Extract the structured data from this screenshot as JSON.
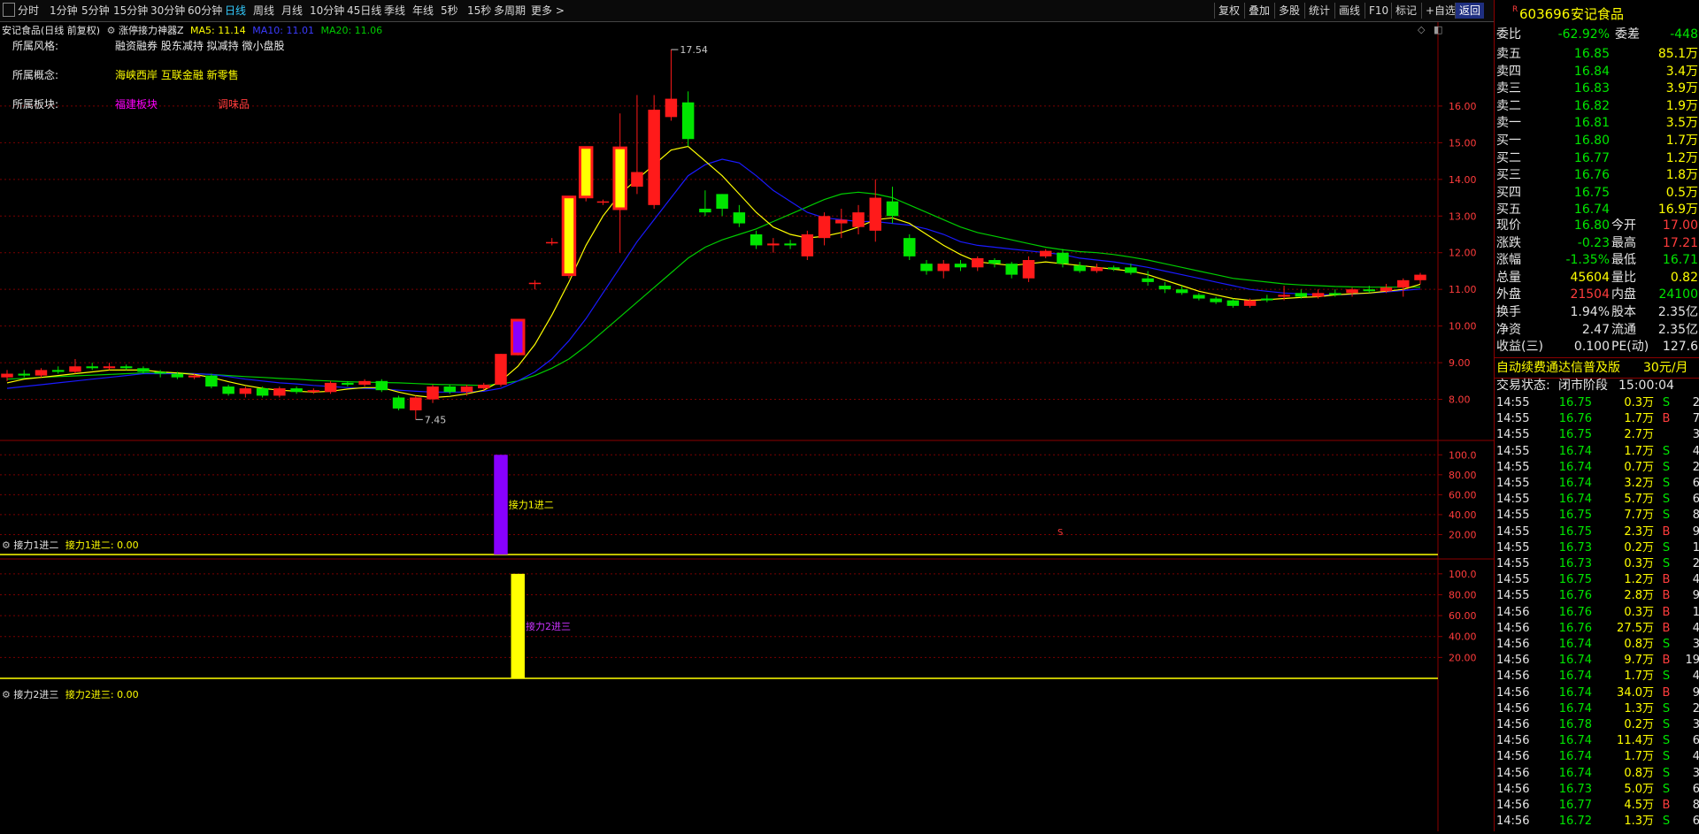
{
  "toolbar": {
    "periods": [
      "分时",
      "1分钟",
      "5分钟",
      "15分钟",
      "30分钟",
      "60分钟",
      "日线",
      "周线",
      "月线",
      "10分钟",
      "45日线",
      "季线",
      "年线",
      "5秒",
      "15秒",
      "多周期",
      "更多 >"
    ],
    "active_period": "日线",
    "right_buttons": [
      "复权",
      "叠加",
      "多股",
      "统计",
      "画线",
      "F10",
      "标记",
      "+自选",
      "返回"
    ],
    "active_right": "返回"
  },
  "main_chart": {
    "title": "安记食品(日线 前复权)",
    "indicator_name": "涨停接力神器Z",
    "ma5_label": "MA5: 11.14",
    "ma10_label": "MA10: 11.01",
    "ma20_label": "MA20: 11.06",
    "info": [
      {
        "label": "所属风格:",
        "value": "融资融券 股东减持 拟减持 微小盘股"
      },
      {
        "label": "所属概念:",
        "value": "海峡西岸 互联金融 新零售"
      },
      {
        "label": "所属板块:",
        "value": "福建板块",
        "value2": "调味品"
      }
    ],
    "high_marker": "17.54",
    "low_marker": "7.45",
    "y_ticks": [
      "16.00",
      "15.00",
      "14.00",
      "13.00",
      "12.00",
      "11.00",
      "10.00",
      "9.00",
      "8.00"
    ],
    "bottom_marker": "S",
    "colors": {
      "up": "#ff1a1a",
      "down": "#00e600",
      "ma5": "#ffff00",
      "ma10": "#1a1aff",
      "ma20": "#00cc00",
      "grid": "#7a0000"
    }
  },
  "chart_data": {
    "type": "candlestick",
    "y_range": [
      7.0,
      18.0
    ],
    "candles": [
      [
        8.6,
        8.7,
        8.5,
        8.8
      ],
      [
        8.7,
        8.65,
        8.6,
        8.8
      ],
      [
        8.65,
        8.8,
        8.6,
        8.85
      ],
      [
        8.8,
        8.75,
        8.7,
        8.9
      ],
      [
        8.75,
        8.9,
        8.7,
        9.1
      ],
      [
        8.9,
        8.85,
        8.8,
        9.0
      ],
      [
        8.85,
        8.9,
        8.8,
        9.0
      ],
      [
        8.9,
        8.85,
        8.8,
        8.95
      ],
      [
        8.85,
        8.75,
        8.7,
        8.9
      ],
      [
        8.75,
        8.7,
        8.6,
        8.8
      ],
      [
        8.7,
        8.6,
        8.55,
        8.75
      ],
      [
        8.6,
        8.65,
        8.55,
        8.7
      ],
      [
        8.65,
        8.35,
        8.3,
        8.7
      ],
      [
        8.35,
        8.15,
        8.1,
        8.4
      ],
      [
        8.15,
        8.3,
        8.05,
        8.35
      ],
      [
        8.3,
        8.1,
        8.05,
        8.35
      ],
      [
        8.1,
        8.3,
        8.05,
        8.35
      ],
      [
        8.3,
        8.2,
        8.15,
        8.35
      ],
      [
        8.2,
        8.25,
        8.15,
        8.3
      ],
      [
        8.2,
        8.45,
        8.15,
        8.5
      ],
      [
        8.45,
        8.4,
        8.35,
        8.5
      ],
      [
        8.4,
        8.5,
        8.35,
        8.55
      ],
      [
        8.5,
        8.25,
        8.2,
        8.55
      ],
      [
        8.05,
        7.75,
        7.7,
        8.1
      ],
      [
        7.7,
        8.05,
        7.45,
        8.1
      ],
      [
        8.0,
        8.35,
        7.9,
        8.4
      ],
      [
        8.35,
        8.2,
        8.15,
        8.4
      ],
      [
        8.2,
        8.35,
        8.1,
        8.4
      ],
      [
        8.3,
        8.4,
        8.25,
        8.45
      ],
      [
        8.4,
        9.24,
        8.35,
        9.24
      ],
      [
        9.24,
        10.16,
        9.2,
        10.16
      ],
      [
        11.18,
        11.18,
        11.0,
        11.25
      ],
      [
        12.29,
        12.29,
        12.2,
        12.4
      ],
      [
        11.4,
        13.52,
        11.3,
        13.52
      ],
      [
        13.52,
        14.87,
        13.4,
        14.87
      ],
      [
        13.4,
        13.4,
        13.3,
        13.45
      ],
      [
        13.2,
        14.86,
        12.0,
        15.8
      ],
      [
        13.8,
        14.2,
        13.6,
        16.3
      ],
      [
        13.3,
        15.9,
        13.2,
        16.3
      ],
      [
        15.7,
        16.2,
        15.6,
        17.54
      ],
      [
        16.1,
        15.1,
        14.9,
        16.4
      ],
      [
        13.2,
        13.1,
        13.0,
        13.7
      ],
      [
        13.6,
        13.2,
        13.0,
        13.6
      ],
      [
        13.1,
        12.8,
        12.7,
        13.3
      ],
      [
        12.5,
        12.2,
        12.1,
        12.6
      ],
      [
        12.2,
        12.25,
        12.0,
        12.4
      ],
      [
        12.25,
        12.2,
        12.1,
        12.35
      ],
      [
        11.9,
        12.5,
        11.8,
        12.6
      ],
      [
        12.4,
        13.0,
        12.2,
        13.1
      ],
      [
        12.8,
        12.9,
        12.4,
        13.2
      ],
      [
        12.7,
        13.1,
        12.5,
        13.3
      ],
      [
        12.6,
        13.5,
        12.3,
        14.0
      ],
      [
        13.4,
        13.0,
        12.8,
        13.8
      ],
      [
        12.4,
        11.9,
        11.8,
        12.5
      ],
      [
        11.7,
        11.5,
        11.4,
        11.8
      ],
      [
        11.5,
        11.7,
        11.3,
        11.8
      ],
      [
        11.7,
        11.6,
        11.5,
        11.8
      ],
      [
        11.6,
        11.85,
        11.5,
        11.9
      ],
      [
        11.8,
        11.7,
        11.6,
        11.85
      ],
      [
        11.7,
        11.4,
        11.3,
        11.75
      ],
      [
        11.3,
        11.8,
        11.2,
        11.9
      ],
      [
        11.9,
        12.05,
        11.85,
        12.1
      ],
      [
        12.0,
        11.7,
        11.6,
        12.1
      ],
      [
        11.65,
        11.5,
        11.45,
        11.75
      ],
      [
        11.5,
        11.6,
        11.45,
        11.7
      ],
      [
        11.6,
        11.55,
        11.5,
        11.65
      ],
      [
        11.6,
        11.45,
        11.4,
        11.7
      ],
      [
        11.3,
        11.2,
        11.1,
        11.5
      ],
      [
        11.1,
        11.0,
        10.9,
        11.2
      ],
      [
        11.0,
        10.9,
        10.85,
        11.1
      ],
      [
        10.85,
        10.75,
        10.7,
        10.9
      ],
      [
        10.75,
        10.65,
        10.6,
        10.8
      ],
      [
        10.7,
        10.55,
        10.5,
        10.75
      ],
      [
        10.55,
        10.7,
        10.5,
        10.75
      ],
      [
        10.75,
        10.7,
        10.65,
        10.85
      ],
      [
        10.8,
        10.85,
        10.7,
        11.1
      ],
      [
        10.9,
        10.8,
        10.75,
        11.0
      ],
      [
        10.8,
        10.9,
        10.75,
        11.0
      ],
      [
        10.9,
        10.85,
        10.8,
        11.0
      ],
      [
        10.9,
        11.0,
        10.8,
        11.05
      ],
      [
        11.0,
        10.95,
        10.9,
        11.1
      ],
      [
        10.95,
        11.05,
        10.9,
        11.15
      ],
      [
        11.05,
        11.25,
        10.8,
        11.3
      ],
      [
        11.25,
        11.4,
        11.15,
        11.45
      ]
    ],
    "ma5": [
      8.45,
      8.55,
      8.6,
      8.65,
      8.7,
      8.75,
      8.8,
      8.8,
      8.8,
      8.75,
      8.72,
      8.68,
      8.6,
      8.48,
      8.38,
      8.3,
      8.25,
      8.22,
      8.2,
      8.22,
      8.28,
      8.32,
      8.32,
      8.2,
      8.1,
      8.05,
      8.08,
      8.15,
      8.25,
      8.5,
      8.9,
      9.5,
      10.3,
      11.2,
      12.2,
      13.0,
      13.6,
      14.0,
      14.4,
      14.8,
      14.9,
      14.5,
      14.1,
      13.6,
      13.1,
      12.7,
      12.5,
      12.4,
      12.45,
      12.55,
      12.7,
      12.9,
      12.95,
      12.8,
      12.5,
      12.2,
      11.95,
      11.75,
      11.7,
      11.65,
      11.7,
      11.75,
      11.7,
      11.65,
      11.6,
      11.55,
      11.5,
      11.4,
      11.25,
      11.1,
      10.95,
      10.85,
      10.75,
      10.7,
      10.72,
      10.75,
      10.78,
      10.8,
      10.85,
      10.88,
      10.9,
      10.95,
      11.0,
      11.14
    ],
    "ma10": [
      8.3,
      8.35,
      8.4,
      8.45,
      8.5,
      8.55,
      8.6,
      8.65,
      8.7,
      8.7,
      8.7,
      8.7,
      8.68,
      8.62,
      8.55,
      8.5,
      8.45,
      8.42,
      8.38,
      8.35,
      8.32,
      8.3,
      8.28,
      8.25,
      8.22,
      8.2,
      8.2,
      8.2,
      8.22,
      8.3,
      8.5,
      8.75,
      9.1,
      9.6,
      10.2,
      10.9,
      11.6,
      12.3,
      12.9,
      13.5,
      14.1,
      14.4,
      14.55,
      14.45,
      14.1,
      13.7,
      13.4,
      13.1,
      12.95,
      12.9,
      12.85,
      12.85,
      12.8,
      12.75,
      12.65,
      12.5,
      12.3,
      12.2,
      12.15,
      12.1,
      12.05,
      12.0,
      11.95,
      11.85,
      11.8,
      11.75,
      11.68,
      11.6,
      11.5,
      11.4,
      11.3,
      11.2,
      11.1,
      11.0,
      10.95,
      10.9,
      10.88,
      10.85,
      10.85,
      10.87,
      10.9,
      10.93,
      10.97,
      11.01
    ],
    "ma20": [
      8.55,
      8.57,
      8.6,
      8.62,
      8.64,
      8.66,
      8.68,
      8.7,
      8.72,
      8.72,
      8.72,
      8.7,
      8.68,
      8.65,
      8.62,
      8.6,
      8.57,
      8.55,
      8.52,
      8.5,
      8.48,
      8.47,
      8.46,
      8.45,
      8.43,
      8.41,
      8.4,
      8.39,
      8.38,
      8.42,
      8.5,
      8.65,
      8.85,
      9.1,
      9.45,
      9.85,
      10.25,
      10.65,
      11.05,
      11.45,
      11.85,
      12.15,
      12.35,
      12.5,
      12.65,
      12.85,
      13.05,
      13.25,
      13.45,
      13.6,
      13.65,
      13.6,
      13.5,
      13.3,
      13.1,
      12.9,
      12.7,
      12.55,
      12.45,
      12.35,
      12.25,
      12.15,
      12.08,
      12.03,
      12.0,
      11.95,
      11.88,
      11.8,
      11.7,
      11.6,
      11.5,
      11.4,
      11.3,
      11.25,
      11.2,
      11.15,
      11.12,
      11.1,
      11.08,
      11.07,
      11.06,
      11.06,
      11.06,
      11.06
    ],
    "sub1_bar_index": 29,
    "sub2_bar_index": 30,
    "sub_y_range": [
      0,
      110
    ]
  },
  "sub1": {
    "title": "接力1进二",
    "label": "接力1进二: 0.00",
    "annotation": "接力1进二",
    "bar_value": 100,
    "y_ticks": [
      "100.0",
      "80.00",
      "60.00",
      "40.00",
      "20.00"
    ],
    "bar_color": "#8800ff"
  },
  "sub2": {
    "title": "接力2进三",
    "label": "接力2进三: 0.00",
    "annotation": "接力2进三",
    "bar_value": 100,
    "y_ticks": [
      "100.0",
      "80.00",
      "60.00",
      "40.00",
      "20.00"
    ],
    "bar_color": "#ffff00"
  },
  "quote": {
    "code": "603696",
    "name": "安记食品",
    "weibi_label": "委比",
    "weibi": "-62.92%",
    "weicha_label": "委差",
    "weicha": "-448",
    "asks": [
      {
        "label": "卖五",
        "price": "16.85",
        "vol": "85.1万"
      },
      {
        "label": "卖四",
        "price": "16.84",
        "vol": "3.4万"
      },
      {
        "label": "卖三",
        "price": "16.83",
        "vol": "3.9万"
      },
      {
        "label": "卖二",
        "price": "16.82",
        "vol": "1.9万"
      },
      {
        "label": "卖一",
        "price": "16.81",
        "vol": "3.5万"
      }
    ],
    "bids": [
      {
        "label": "买一",
        "price": "16.80",
        "vol": "1.7万"
      },
      {
        "label": "买二",
        "price": "16.77",
        "vol": "1.2万"
      },
      {
        "label": "买三",
        "price": "16.76",
        "vol": "1.8万"
      },
      {
        "label": "买四",
        "price": "16.75",
        "vol": "0.5万"
      },
      {
        "label": "买五",
        "price": "16.74",
        "vol": "16.9万"
      }
    ],
    "stats": [
      {
        "l1": "现价",
        "v1": "16.80",
        "c1": "green",
        "l2": "今开",
        "v2": "17.00",
        "c2": "red"
      },
      {
        "l1": "涨跌",
        "v1": "-0.23",
        "c1": "green",
        "l2": "最高",
        "v2": "17.21",
        "c2": "red"
      },
      {
        "l1": "涨幅",
        "v1": "-1.35%",
        "c1": "green",
        "l2": "最低",
        "v2": "16.71",
        "c2": "green"
      },
      {
        "l1": "总量",
        "v1": "45604",
        "c1": "yellow",
        "l2": "量比",
        "v2": "0.82",
        "c2": "yellow"
      },
      {
        "l1": "外盘",
        "v1": "21504",
        "c1": "red",
        "l2": "内盘",
        "v2": "24100",
        "c2": "green"
      }
    ],
    "stats2": [
      {
        "l1": "换手",
        "v1": "1.94%",
        "l2": "股本",
        "v2": "2.35亿"
      },
      {
        "l1": "净资",
        "v1": "2.47",
        "l2": "流通",
        "v2": "2.35亿"
      },
      {
        "l1": "收益(三)",
        "v1": "0.100",
        "l2": "PE(动)",
        "v2": "127.6"
      }
    ],
    "banner": "自动续费通达信普及版",
    "banner_price": "30元/月",
    "trade_status_label": "交易状态:",
    "trade_status": "闭市阶段",
    "trade_time": "15:00:04"
  },
  "ticks": [
    {
      "t": "14:55",
      "p": "16.75",
      "pc": "green",
      "v": "0.3万",
      "d": "S",
      "n": "2"
    },
    {
      "t": "14:55",
      "p": "16.76",
      "pc": "green",
      "v": "1.7万",
      "d": "B",
      "n": "7"
    },
    {
      "t": "14:55",
      "p": "16.75",
      "pc": "green",
      "v": "2.7万",
      "d": "",
      "n": "3"
    },
    {
      "t": "14:55",
      "p": "16.74",
      "pc": "green",
      "v": "1.7万",
      "d": "S",
      "n": "4"
    },
    {
      "t": "14:55",
      "p": "16.74",
      "pc": "green",
      "v": "0.7万",
      "d": "S",
      "n": "2"
    },
    {
      "t": "14:55",
      "p": "16.74",
      "pc": "green",
      "v": "3.2万",
      "d": "S",
      "n": "6"
    },
    {
      "t": "14:55",
      "p": "16.74",
      "pc": "green",
      "v": "5.7万",
      "d": "S",
      "n": "6"
    },
    {
      "t": "14:55",
      "p": "16.75",
      "pc": "green",
      "v": "7.7万",
      "d": "S",
      "n": "8"
    },
    {
      "t": "14:55",
      "p": "16.75",
      "pc": "green",
      "v": "2.3万",
      "d": "B",
      "n": "9"
    },
    {
      "t": "14:55",
      "p": "16.73",
      "pc": "green",
      "v": "0.2万",
      "d": "S",
      "n": "1"
    },
    {
      "t": "14:55",
      "p": "16.73",
      "pc": "green",
      "v": "0.3万",
      "d": "S",
      "n": "2"
    },
    {
      "t": "14:55",
      "p": "16.75",
      "pc": "green",
      "v": "1.2万",
      "d": "B",
      "n": "4"
    },
    {
      "t": "14:55",
      "p": "16.76",
      "pc": "green",
      "v": "2.8万",
      "d": "B",
      "n": "9"
    },
    {
      "t": "14:56",
      "p": "16.76",
      "pc": "green",
      "v": "0.3万",
      "d": "B",
      "n": "1"
    },
    {
      "t": "14:56",
      "p": "16.76",
      "pc": "green",
      "v": "27.5万",
      "d": "B",
      "n": "4"
    },
    {
      "t": "14:56",
      "p": "16.74",
      "pc": "green",
      "v": "0.8万",
      "d": "S",
      "n": "3"
    },
    {
      "t": "14:56",
      "p": "16.74",
      "pc": "green",
      "v": "9.7万",
      "d": "B",
      "n": "19"
    },
    {
      "t": "14:56",
      "p": "16.74",
      "pc": "green",
      "v": "1.7万",
      "d": "S",
      "n": "4"
    },
    {
      "t": "14:56",
      "p": "16.74",
      "pc": "green",
      "v": "34.0万",
      "d": "B",
      "n": "9"
    },
    {
      "t": "14:56",
      "p": "16.74",
      "pc": "green",
      "v": "1.3万",
      "d": "S",
      "n": "2"
    },
    {
      "t": "14:56",
      "p": "16.78",
      "pc": "green",
      "v": "0.2万",
      "d": "S",
      "n": "3"
    },
    {
      "t": "14:56",
      "p": "16.74",
      "pc": "green",
      "v": "11.4万",
      "d": "S",
      "n": "6"
    },
    {
      "t": "14:56",
      "p": "16.74",
      "pc": "green",
      "v": "1.7万",
      "d": "S",
      "n": "4"
    },
    {
      "t": "14:56",
      "p": "16.74",
      "pc": "green",
      "v": "0.8万",
      "d": "S",
      "n": "3"
    },
    {
      "t": "14:56",
      "p": "16.73",
      "pc": "green",
      "v": "5.0万",
      "d": "S",
      "n": "6"
    },
    {
      "t": "14:56",
      "p": "16.77",
      "pc": "green",
      "v": "4.5万",
      "d": "B",
      "n": "8"
    },
    {
      "t": "14:56",
      "p": "16.72",
      "pc": "green",
      "v": "1.3万",
      "d": "S",
      "n": "6"
    }
  ]
}
